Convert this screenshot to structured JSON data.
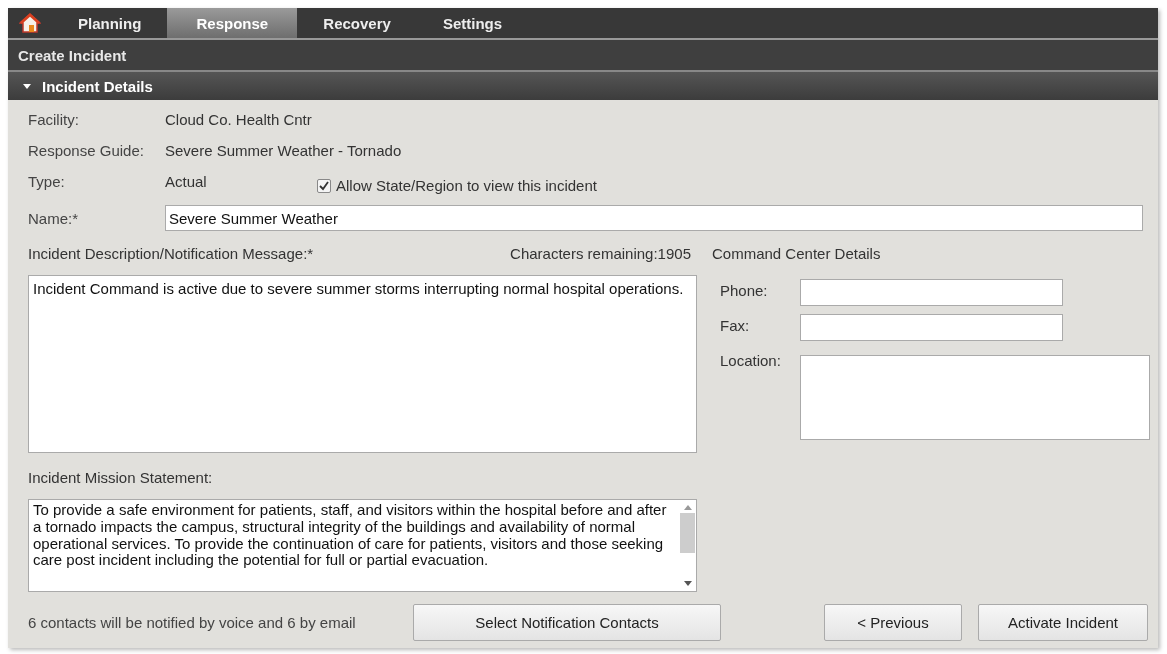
{
  "nav": {
    "tabs": [
      {
        "kind": "home",
        "selected": false
      },
      {
        "kind": "text",
        "label": "Planning",
        "selected": false
      },
      {
        "kind": "text",
        "label": "Response",
        "selected": true
      },
      {
        "kind": "text",
        "label": "Recovery",
        "selected": false
      },
      {
        "kind": "text",
        "label": "Settings",
        "selected": false
      }
    ]
  },
  "page_title": "Create Incident",
  "section": {
    "title": "Incident Details",
    "expanded": true
  },
  "info_rows": [
    {
      "label": "Facility:",
      "value": "Cloud Co. Health Cntr"
    },
    {
      "label": "Response Guide:",
      "value": "Severe Summer Weather - Tornado"
    },
    {
      "label": "Type:",
      "value": "Actual"
    }
  ],
  "allow_view": {
    "label": "Allow State/Region to view this incident",
    "checked": true
  },
  "name_field": {
    "label": "Name:*",
    "value": "Severe Summer Weather"
  },
  "description": {
    "label": "Incident Description/Notification Message:*",
    "counter": "Characters remaining:1905",
    "value": "Incident Command is active due to severe summer storms interrupting normal hospital operations."
  },
  "command_center": {
    "title": "Command Center Details",
    "fields": [
      {
        "label": "Phone:",
        "kind": "line"
      },
      {
        "label": "Fax:",
        "kind": "line"
      },
      {
        "label": "Location:",
        "kind": "area"
      }
    ]
  },
  "mission": {
    "label": "Incident Mission Statement:",
    "value": "To provide a safe environment for patients, staff, and visitors within the hospital before and after a tornado impacts the campus, structural integrity of the buildings and availability of normal operational services. To provide the continuation of care for patients, visitors and those seeking care post incident including the potential for full or partial evacuation."
  },
  "footer": {
    "notice": "6 contacts will be notified by voice and 6 by email",
    "buttons": [
      "Select Notification Contacts",
      "< Previous",
      "Activate Incident"
    ]
  }
}
